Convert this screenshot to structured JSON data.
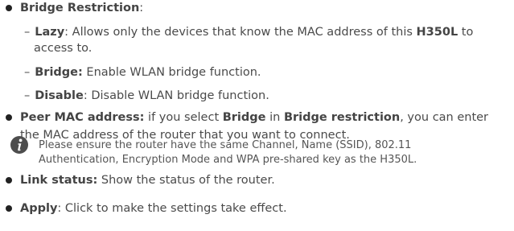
{
  "bridge_restriction": {
    "term": "Bridge Restriction",
    "suffix": ":"
  },
  "lazy": {
    "dash": "–",
    "term": "Lazy",
    "text_before": ": Allows only the devices that know the MAC address of this ",
    "device": "H350L",
    "text_after": " to",
    "continuation": "access to."
  },
  "bridge": {
    "dash": "–",
    "term": "Bridge:",
    "text": " Enable WLAN bridge function."
  },
  "disable": {
    "dash": "–",
    "term": "Disable",
    "text": ": Disable WLAN bridge function."
  },
  "peer_mac": {
    "term": "Peer MAC address:",
    "text1": " if you select ",
    "term2": "Bridge",
    "text2": " in ",
    "term3": "Bridge restriction",
    "text3": ", you can enter",
    "continuation": "the MAC address of the router that you want to connect."
  },
  "note": {
    "icon": "info-icon",
    "line1": "Please ensure the router have the same Channel, Name (SSID), 802.11",
    "line2": "Authentication, Encryption Mode and WPA pre-shared key as the H350L."
  },
  "link_status": {
    "term": "Link status:",
    "text": " Show the status of the router."
  },
  "apply": {
    "term": "Apply",
    "text": ": Click to make the settings take effect."
  }
}
